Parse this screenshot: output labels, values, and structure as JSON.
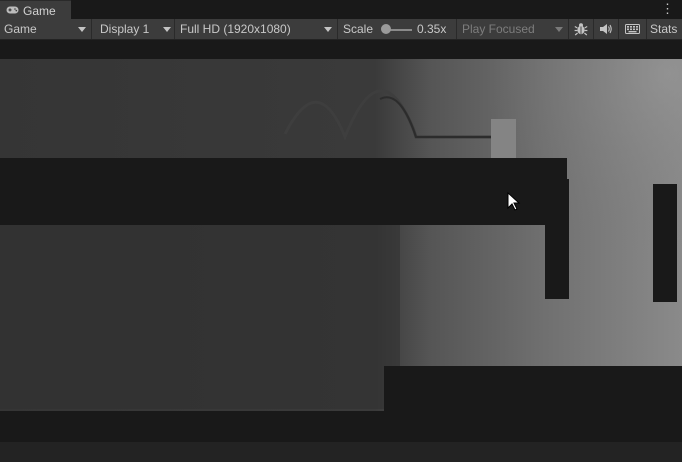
{
  "tab": {
    "title": "Game",
    "icon": "gamepad-icon"
  },
  "toolbar": {
    "view_mode": "Game",
    "display": "Display 1",
    "resolution": "Full HD (1920x1080)",
    "scale_label": "Scale",
    "scale_value": "0.35x",
    "play_mode": "Play Focused",
    "stats_label": "Stats",
    "icons": [
      "bug-icon",
      "audio-icon",
      "keyboard-icon"
    ]
  },
  "colors": {
    "toolbar_bg": "#3c3c3c",
    "platform": "#191919",
    "light": "#8e8e8e",
    "shadow": "#353535"
  }
}
